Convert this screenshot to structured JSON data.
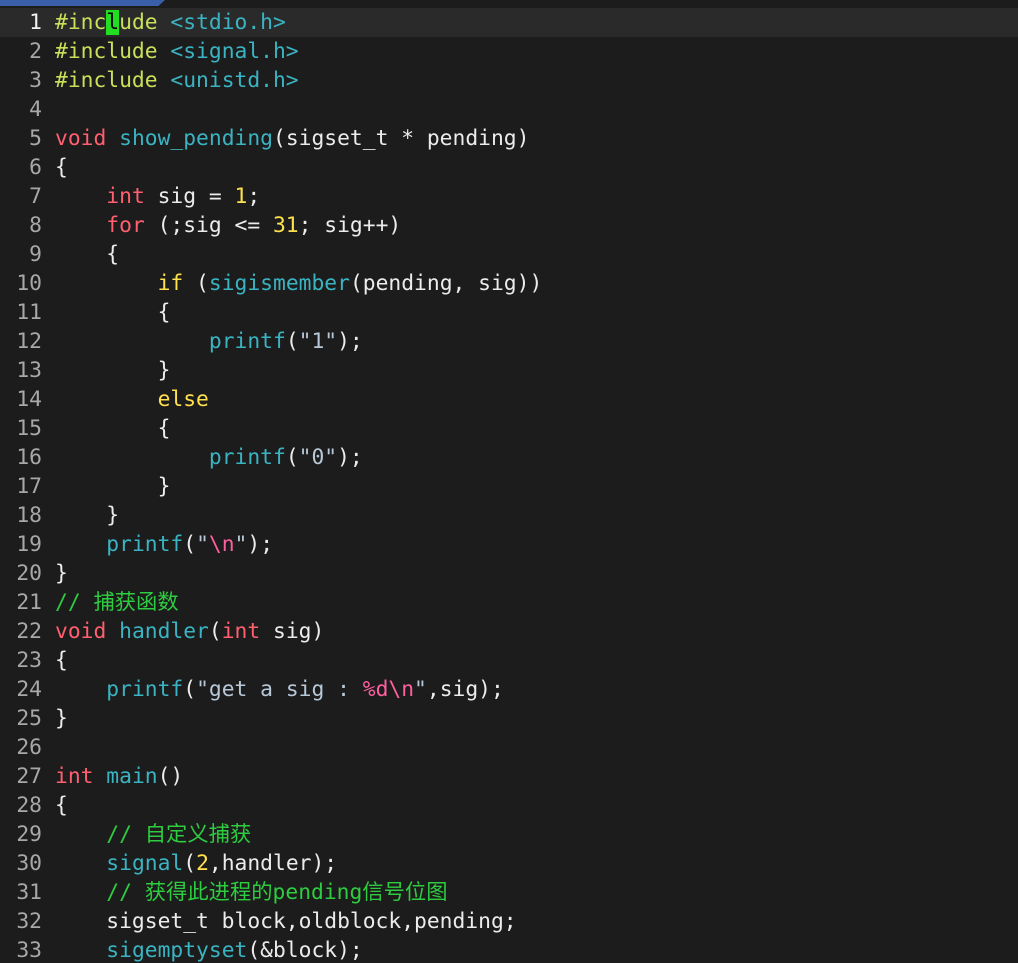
{
  "editor": {
    "current_line": 1,
    "cursor": {
      "line": 1,
      "col": 6
    },
    "colors": {
      "background": "#1c1c1c",
      "current_line": "#2a2a2a",
      "keyword": "#ff5f6e",
      "function": "#3ab4c2",
      "preprocessor": "#c8e05a",
      "number": "#ffe14d",
      "comment": "#2ecc40",
      "cursor": "#22dd22"
    },
    "lines": [
      {
        "n": "1",
        "tokens": [
          [
            "pp",
            "#inc"
          ],
          [
            "cursor",
            "l"
          ],
          [
            "pp",
            "ude "
          ],
          [
            "inc",
            "<stdio.h>"
          ]
        ]
      },
      {
        "n": "2",
        "tokens": [
          [
            "pp",
            "#include "
          ],
          [
            "inc",
            "<signal.h>"
          ]
        ]
      },
      {
        "n": "3",
        "tokens": [
          [
            "pp",
            "#include "
          ],
          [
            "inc",
            "<unistd.h>"
          ]
        ]
      },
      {
        "n": "4",
        "tokens": []
      },
      {
        "n": "5",
        "tokens": [
          [
            "kw",
            "void"
          ],
          [
            "id",
            " "
          ],
          [
            "fn",
            "show_pending"
          ],
          [
            "id",
            "(sigset_t * pending)"
          ]
        ]
      },
      {
        "n": "6",
        "tokens": [
          [
            "id",
            "{"
          ]
        ]
      },
      {
        "n": "7",
        "tokens": [
          [
            "id",
            "    "
          ],
          [
            "kw",
            "int"
          ],
          [
            "id",
            " sig = "
          ],
          [
            "num",
            "1"
          ],
          [
            "id",
            ";"
          ]
        ]
      },
      {
        "n": "8",
        "tokens": [
          [
            "id",
            "    "
          ],
          [
            "kw",
            "for"
          ],
          [
            "id",
            " (;sig <= "
          ],
          [
            "num",
            "31"
          ],
          [
            "id",
            "; sig++)"
          ]
        ]
      },
      {
        "n": "9",
        "tokens": [
          [
            "id",
            "    {"
          ]
        ]
      },
      {
        "n": "10",
        "tokens": [
          [
            "id",
            "        "
          ],
          [
            "ctl",
            "if"
          ],
          [
            "id",
            " ("
          ],
          [
            "fn",
            "sigismember"
          ],
          [
            "id",
            "(pending, sig))"
          ]
        ]
      },
      {
        "n": "11",
        "tokens": [
          [
            "id",
            "        {"
          ]
        ]
      },
      {
        "n": "12",
        "tokens": [
          [
            "id",
            "            "
          ],
          [
            "fn",
            "printf"
          ],
          [
            "id",
            "("
          ],
          [
            "str",
            "\"1\""
          ],
          [
            "id",
            ");"
          ]
        ]
      },
      {
        "n": "13",
        "tokens": [
          [
            "id",
            "        }"
          ]
        ]
      },
      {
        "n": "14",
        "tokens": [
          [
            "id",
            "        "
          ],
          [
            "ctl",
            "else"
          ]
        ]
      },
      {
        "n": "15",
        "tokens": [
          [
            "id",
            "        {"
          ]
        ]
      },
      {
        "n": "16",
        "tokens": [
          [
            "id",
            "            "
          ],
          [
            "fn",
            "printf"
          ],
          [
            "id",
            "("
          ],
          [
            "str",
            "\"0\""
          ],
          [
            "id",
            ");"
          ]
        ]
      },
      {
        "n": "17",
        "tokens": [
          [
            "id",
            "        }"
          ]
        ]
      },
      {
        "n": "18",
        "tokens": [
          [
            "id",
            "    }"
          ]
        ]
      },
      {
        "n": "19",
        "tokens": [
          [
            "id",
            "    "
          ],
          [
            "fn",
            "printf"
          ],
          [
            "id",
            "("
          ],
          [
            "str",
            "\""
          ],
          [
            "esc",
            "\\n"
          ],
          [
            "str",
            "\""
          ],
          [
            "id",
            ");"
          ]
        ]
      },
      {
        "n": "20",
        "tokens": [
          [
            "id",
            "}"
          ]
        ]
      },
      {
        "n": "21",
        "tokens": [
          [
            "cm",
            "// 捕获函数"
          ]
        ]
      },
      {
        "n": "22",
        "tokens": [
          [
            "kw",
            "void"
          ],
          [
            "id",
            " "
          ],
          [
            "fn",
            "handler"
          ],
          [
            "id",
            "("
          ],
          [
            "kw",
            "int"
          ],
          [
            "id",
            " sig)"
          ]
        ]
      },
      {
        "n": "23",
        "tokens": [
          [
            "id",
            "{"
          ]
        ]
      },
      {
        "n": "24",
        "tokens": [
          [
            "id",
            "    "
          ],
          [
            "fn",
            "printf"
          ],
          [
            "id",
            "("
          ],
          [
            "str",
            "\"get a sig : "
          ],
          [
            "esc",
            "%d\\n"
          ],
          [
            "str",
            "\""
          ],
          [
            "id",
            ",sig);"
          ]
        ]
      },
      {
        "n": "25",
        "tokens": [
          [
            "id",
            "}"
          ]
        ]
      },
      {
        "n": "26",
        "tokens": []
      },
      {
        "n": "27",
        "tokens": [
          [
            "kw",
            "int"
          ],
          [
            "id",
            " "
          ],
          [
            "fn",
            "main"
          ],
          [
            "id",
            "()"
          ]
        ]
      },
      {
        "n": "28",
        "tokens": [
          [
            "id",
            "{"
          ]
        ]
      },
      {
        "n": "29",
        "tokens": [
          [
            "id",
            "    "
          ],
          [
            "cm",
            "// 自定义捕获"
          ]
        ]
      },
      {
        "n": "30",
        "tokens": [
          [
            "id",
            "    "
          ],
          [
            "fn",
            "signal"
          ],
          [
            "id",
            "("
          ],
          [
            "num",
            "2"
          ],
          [
            "id",
            ",handler);"
          ]
        ]
      },
      {
        "n": "31",
        "tokens": [
          [
            "id",
            "    "
          ],
          [
            "cm",
            "// 获得此进程的pending信号位图"
          ]
        ]
      },
      {
        "n": "32",
        "tokens": [
          [
            "id",
            "    sigset_t block,oldblock,pending;"
          ]
        ]
      },
      {
        "n": "33",
        "tokens": [
          [
            "id",
            "    "
          ],
          [
            "fn",
            "sigemptyset"
          ],
          [
            "id",
            "(&block);"
          ]
        ]
      }
    ]
  }
}
